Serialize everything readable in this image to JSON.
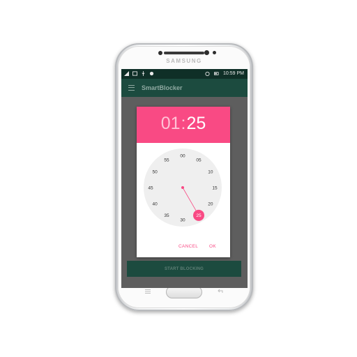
{
  "device": {
    "brand": "SAMSUNG"
  },
  "statusbar": {
    "time": "10:59 PM"
  },
  "appbar": {
    "title": "SmartBlocker"
  },
  "dialog": {
    "hour": "01",
    "separator": ":",
    "minute": "25",
    "cancel_label": "CANCEL",
    "ok_label": "OK",
    "minute_labels": [
      "00",
      "05",
      "10",
      "15",
      "20",
      "25",
      "30",
      "35",
      "40",
      "45",
      "50",
      "55"
    ],
    "selected_minute": 25,
    "accent_color": "#f94a84"
  },
  "start_button": {
    "label": "START BLOCKING"
  },
  "colors": {
    "appbar": "#1c4b3f",
    "statusbar": "#0f2f27",
    "accent": "#f94a84"
  }
}
